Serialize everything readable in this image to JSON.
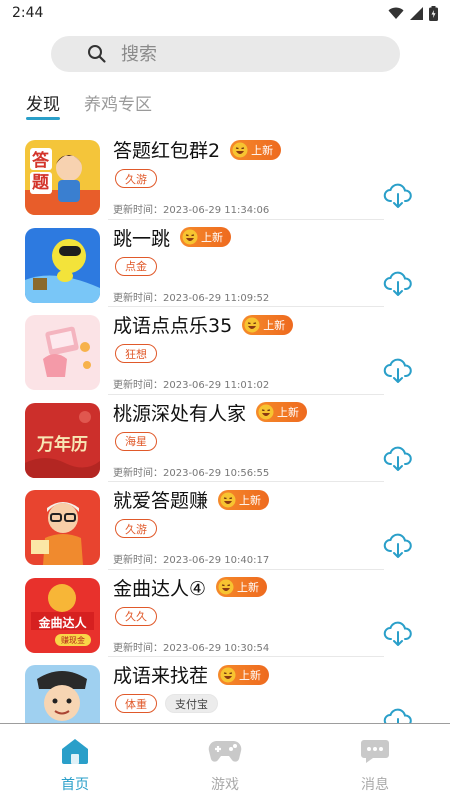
{
  "status": {
    "time": "2:44"
  },
  "search": {
    "placeholder": "搜索"
  },
  "tabs": [
    {
      "label": "发现",
      "active": true
    },
    {
      "label": "养鸡专区",
      "active": false
    }
  ],
  "labels": {
    "new_badge": "上新"
  },
  "apps": [
    {
      "title": "答题红包群2",
      "tags": [
        "久游"
      ],
      "update": "更新时间：2023-06-29 11:34:06",
      "icon_text": "答题"
    },
    {
      "title": "跳一跳",
      "tags": [
        "点金"
      ],
      "update": "更新时间：2023-06-29 11:09:52"
    },
    {
      "title": "成语点点乐35",
      "tags": [
        "狂想"
      ],
      "update": "更新时间：2023-06-29 11:01:02"
    },
    {
      "title": "桃源深处有人家",
      "tags": [
        "海星"
      ],
      "update": "更新时间：2023-06-29 10:56:55",
      "icon_text": "万年历"
    },
    {
      "title": "就爱答题赚",
      "tags": [
        "久游"
      ],
      "update": "更新时间：2023-06-29 10:40:17"
    },
    {
      "title": "金曲达人④",
      "tags": [
        "久久"
      ],
      "update": "更新时间：2023-06-29 10:30:54",
      "icon_text": "金曲达人",
      "icon_subtext": "赚现金"
    },
    {
      "title": "成语来找茬",
      "tags": [
        "体重",
        "支付宝"
      ],
      "update": ""
    }
  ],
  "bottom_nav": [
    {
      "label": "首页",
      "active": true,
      "icon": "home-icon"
    },
    {
      "label": "游戏",
      "active": false,
      "icon": "gamepad-icon"
    },
    {
      "label": "消息",
      "active": false,
      "icon": "chat-icon"
    }
  ],
  "colors": {
    "accent": "#2a9fc9",
    "badge": "#ee6a1f",
    "tag": "#e0592a"
  }
}
